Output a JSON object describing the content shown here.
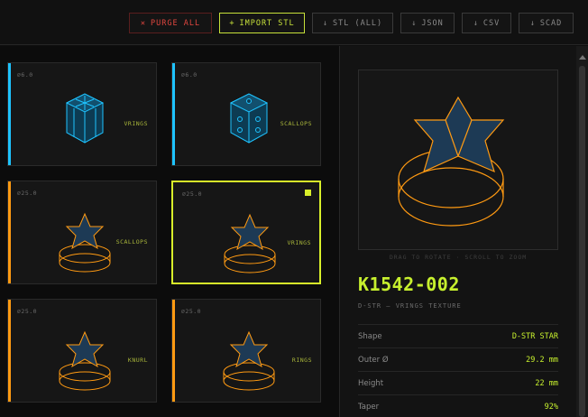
{
  "toolbar": {
    "purge": {
      "icon": "x-icon",
      "glyph": "✕",
      "label": "PURGE ALL"
    },
    "import": {
      "glyph": "+",
      "label": "IMPORT STL"
    },
    "stl_all": {
      "glyph": "↓",
      "label": "STL (ALL)"
    },
    "json": {
      "glyph": "↓",
      "label": "JSON"
    },
    "csv": {
      "glyph": "↓",
      "label": "CSV"
    },
    "scad": {
      "glyph": "↓",
      "label": "SCAD"
    }
  },
  "cards": [
    {
      "diameter": "⌀6.0",
      "texture": "VRINGS",
      "shape": "hex",
      "color": "#1ec3ff"
    },
    {
      "diameter": "⌀6.0",
      "texture": "SCALLOPS",
      "shape": "hex",
      "color": "#1ec3ff"
    },
    {
      "diameter": "⌀25.0",
      "texture": "SCALLOPS",
      "shape": "star",
      "color": "#ff9a12"
    },
    {
      "diameter": "⌀25.0",
      "texture": "VRINGS",
      "shape": "star",
      "color": "#ff9a12",
      "selected": true
    },
    {
      "diameter": "⌀25.0",
      "texture": "KNURL",
      "shape": "star",
      "color": "#ff9a12"
    },
    {
      "diameter": "⌀25.0",
      "texture": "RINGS",
      "shape": "star",
      "color": "#ff9a12"
    }
  ],
  "detail": {
    "hint": "DRAG TO ROTATE · SCROLL TO ZOOM",
    "code": "K1542-002",
    "subtitle": "D-STR — VRINGS TEXTURE",
    "props": [
      {
        "key": "Shape",
        "value": "D-STR STAR"
      },
      {
        "key": "Outer Ø",
        "value": "29.2 mm"
      },
      {
        "key": "Height",
        "value": "22 mm"
      },
      {
        "key": "Taper",
        "value": "92%"
      }
    ]
  },
  "colors": {
    "accent": "#c7f02e",
    "orange": "#ff9a12",
    "cyan": "#1ec3ff",
    "danger": "#e0463f"
  }
}
